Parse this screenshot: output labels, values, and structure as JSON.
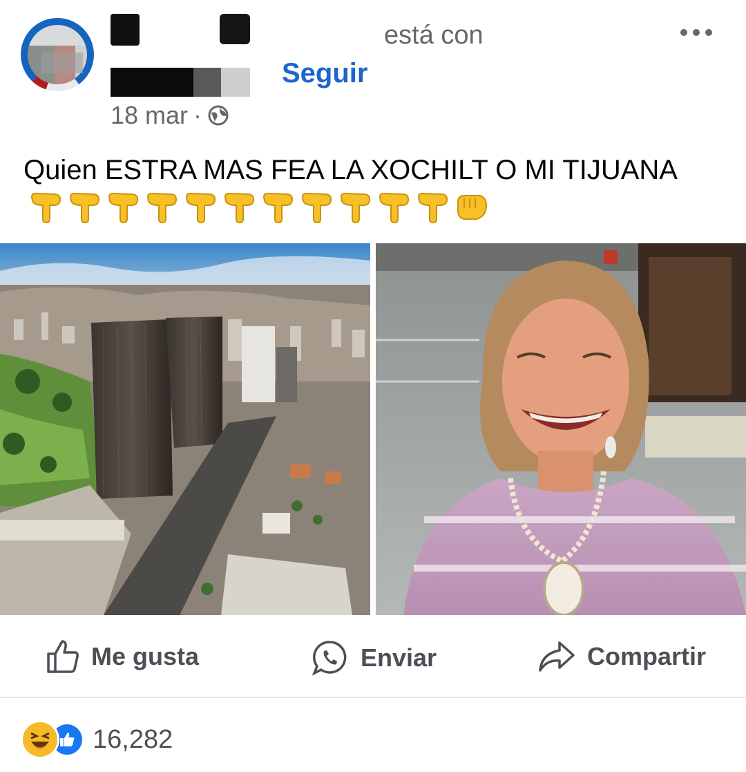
{
  "header": {
    "with_text": "está con",
    "follow_label": "Seguir",
    "date": "18 mar",
    "separator": "·",
    "privacy_icon": "globe-icon",
    "more_icon": "more-dots-icon"
  },
  "post": {
    "text": "Quien ESTRA MAS FEA LA XOCHILT O MI TIJUANA",
    "emoji_icons": "backhand-index-pointing-down-icon ×11, oncoming-fist-icon"
  },
  "photos": [
    {
      "semantic": "tijuana-city-aerial-photo"
    },
    {
      "semantic": "woman-smiling-photo"
    }
  ],
  "actions": {
    "like_label": "Me gusta",
    "send_label": "Enviar",
    "share_label": "Compartir"
  },
  "reactions": {
    "count": "16,282",
    "icons": [
      "haha-reaction-icon",
      "like-reaction-icon"
    ]
  },
  "colors": {
    "accent": "#1b66c9",
    "muted": "#65676b",
    "action_text": "#4b4f56"
  }
}
